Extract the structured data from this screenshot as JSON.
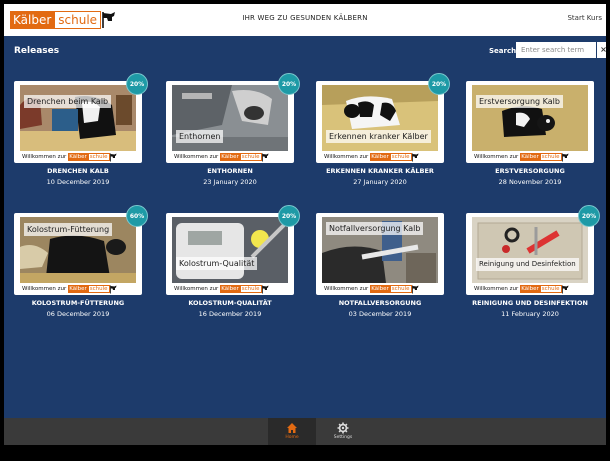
{
  "header": {
    "logo_part1": "Kälber",
    "logo_part2": "schule",
    "tagline": "IHR WEG ZU GESUNDEN KÄLBERN",
    "start_link": "Start Kurs"
  },
  "section": {
    "title": "Releases",
    "search_label": "Search",
    "search_placeholder": "Enter search term",
    "search_clear": "×"
  },
  "brand": {
    "willkommen": "Willkommen zur",
    "orange": "#e26a12",
    "badge_color": "#1e9aa6",
    "background": "#1d3b6b"
  },
  "cards": [
    {
      "caption": "Drenchen beim Kalb",
      "badge": "20%",
      "title": "DRENCHEN KALB",
      "date": "10 December 2019"
    },
    {
      "caption": "Enthornen",
      "badge": "20%",
      "title": "ENTHORNEN",
      "date": "23 January 2020"
    },
    {
      "caption": "Erkennen kranker Kälber",
      "badge": "20%",
      "title": "ERKENNEN KRANKER KÄLBER",
      "date": "27 January 2020"
    },
    {
      "caption": "Erstversorgung Kalb",
      "badge": "",
      "title": "ERSTVERSORGUNG",
      "date": "28 November 2019"
    },
    {
      "caption": "Kolostrum-Fütterung",
      "badge": "60%",
      "title": "KOLOSTRUM-FÜTTERUNG",
      "date": "06 December 2019"
    },
    {
      "caption": "Kolostrum-Qualität",
      "badge": "20%",
      "title": "KOLOSTRUM-QUALITÄT",
      "date": "16 December 2019"
    },
    {
      "caption": "Notfallversorgung Kalb",
      "badge": "",
      "title": "NOTFALLVERSORGUNG",
      "date": "03 December 2019"
    },
    {
      "caption": "Reinigung und Desinfektion",
      "badge": "20%",
      "title": "REINIGUNG UND DESINFEKTION",
      "date": "11 February 2020"
    }
  ],
  "nav": {
    "home_label": "Home",
    "settings_label": "Settings",
    "home_icon": "home-icon",
    "settings_icon": "gear-icon"
  }
}
